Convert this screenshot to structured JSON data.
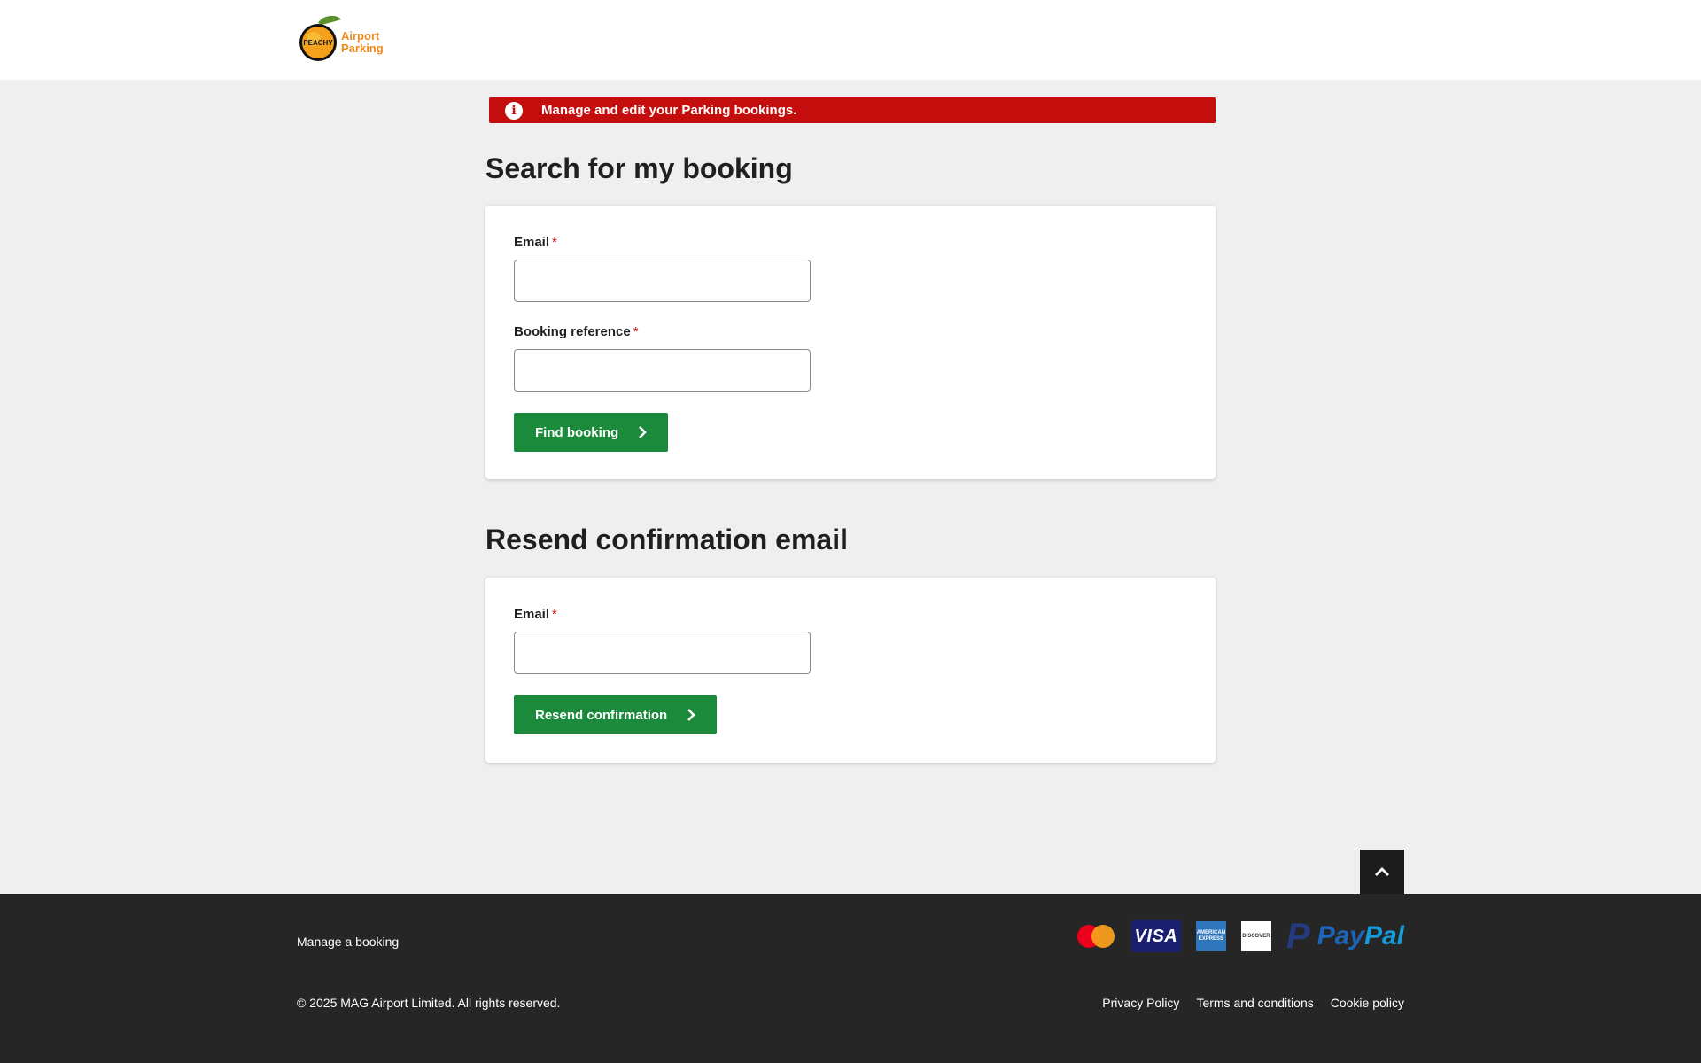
{
  "header": {
    "logo": {
      "brand_word": "PEACHY",
      "line1": "Airport",
      "line2": "Parking"
    }
  },
  "alert": {
    "icon": "info-icon",
    "message": "Manage and edit your Parking bookings.",
    "color": "#c40d0d"
  },
  "search_section": {
    "title": "Search for my booking",
    "email_label": "Email",
    "email_value": "",
    "reference_label": "Booking reference",
    "reference_value": "",
    "required_marker": "*",
    "button_label": "Find booking",
    "button_icon": "chevron-right-icon"
  },
  "resend_section": {
    "title": "Resend confirmation email",
    "email_label": "Email",
    "email_value": "",
    "required_marker": "*",
    "button_label": "Resend confirmation",
    "button_icon": "chevron-right-icon"
  },
  "back_to_top": {
    "icon": "chevron-up-icon"
  },
  "footer": {
    "manage_link": "Manage a booking",
    "copyright": "© 2025 MAG Airport Limited. All rights reserved.",
    "legal_links": [
      "Privacy Policy",
      "Terms and conditions",
      "Cookie policy"
    ],
    "payment_methods": {
      "visa": "VISA",
      "amex": "AMERICAN EXPRESS",
      "discover": "DISCOVER",
      "paypal_pay": "Pay",
      "paypal_pal": "Pal"
    }
  },
  "colors": {
    "primary_button": "#1b8a3a",
    "alert": "#c40d0d",
    "footer": "#262626",
    "background": "#efefef"
  }
}
